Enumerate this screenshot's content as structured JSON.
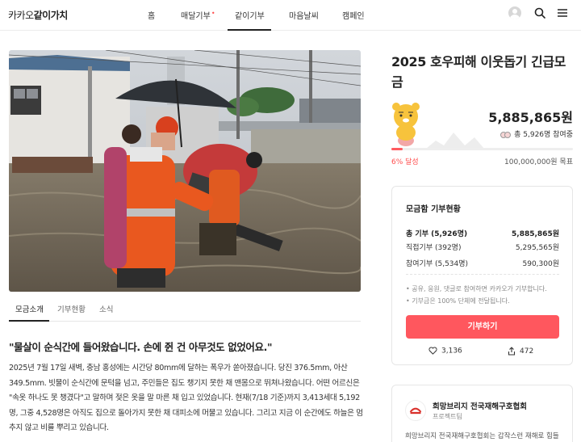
{
  "header": {
    "logo_prefix": "카카오",
    "logo_bold": "같이가치",
    "nav": [
      {
        "label": "홈"
      },
      {
        "label": "매달기부",
        "dot": "•"
      },
      {
        "label": "같이기부"
      },
      {
        "label": "마음날씨"
      },
      {
        "label": "캠페인"
      }
    ]
  },
  "tabs": [
    {
      "label": "모금소개"
    },
    {
      "label": "기부현황"
    },
    {
      "label": "소식"
    }
  ],
  "story": {
    "quote": "\"물살이 순식간에 들어왔습니다. 손에 쥔 건 아무것도 없었어요.\"",
    "body": "2025년 7월 17일 새벽, 충남 홍성에는 시간당 80mm에 달하는 폭우가 쏟아졌습니다. 당진 376.5mm, 아산 349.5mm. 빗물이 순식간에 문턱을 넘고, 주민들은 집도 챙기지 못한 채 맨몸으로 뛰쳐나왔습니다. 어떤 어르신은 \"속옷 하나도 못 챙겼다\"고 말하며 젖은 옷을 말 마른 채 입고 있었습니다. 현재(7/18 기준)까지 3,413세대 5,192명, 그중 4,528명은 아직도 집으로 돌아가지 못한 채 대피소에 머물고 있습니다. 그리고 지금 이 순간에도 하늘은 멈추지 않고 비를 뿌리고 있습니다."
  },
  "campaign": {
    "title": "2025 호우피해 이웃돕기 긴급모금",
    "amount": "5,885,865원",
    "participants": "총 5,926명 참여중",
    "progress_fraction": 0.06,
    "percent_label": "6% 달성",
    "goal_label": "100,000,000원 목표"
  },
  "summary": {
    "title": "모금함 기부현황",
    "rows": [
      {
        "label": "총 기부 (5,926명)",
        "value": "5,885,865원"
      },
      {
        "label": "직접기부 (392명)",
        "value": "5,295,565원"
      },
      {
        "label": "참여기부 (5,534명)",
        "value": "590,300원"
      }
    ],
    "notes": [
      "• 공유, 응원, 댓글로 참여하면 카카오가 기부합니다.",
      "• 기부금은 100% 단체에 전달됩니다."
    ],
    "donate_label": "기부하기",
    "likes": "3,136",
    "shares": "472"
  },
  "org": {
    "name": "희망브리지 전국재해구호협회",
    "type": "프로젝트팀",
    "desc": "희망브리지 전국재해구호협회는 갑작스런 재해로 힘들"
  },
  "colors": {
    "accent": "#ff575e",
    "sky": "#c9cfd6",
    "water": "#6e6658",
    "vest": "#e9581f"
  }
}
